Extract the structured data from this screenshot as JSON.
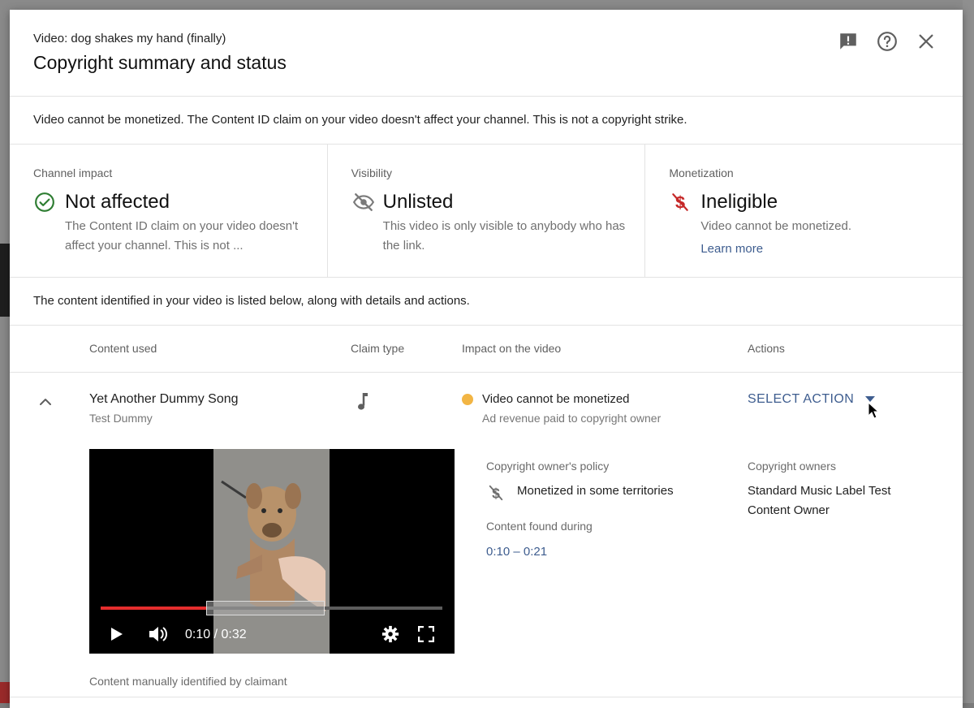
{
  "dialog": {
    "video_title": "Video: dog shakes my hand (finally)",
    "title": "Copyright summary and status",
    "header_icons": [
      "feedback-icon",
      "help-icon",
      "close-icon"
    ]
  },
  "notice": "Video cannot be monetized. The Content ID claim on your video doesn't affect your channel. This is not a copyright strike.",
  "impacts": {
    "channel": {
      "label": "Channel impact",
      "value": "Not affected",
      "desc": "The Content ID claim on your video doesn't affect your channel. This is not ...",
      "icon": "check-circle-icon",
      "color": "#2e7d32"
    },
    "visibility": {
      "label": "Visibility",
      "value": "Unlisted",
      "desc": "This video is only visible to anybody who has the link.",
      "icon": "eye-off-icon"
    },
    "monetization": {
      "label": "Monetization",
      "value": "Ineligible",
      "desc": "Video cannot be monetized.",
      "link": "Learn more",
      "icon": "no-dollar-icon",
      "color": "#c62828"
    }
  },
  "intro": "The content identified in your video is listed below, along with details and actions.",
  "table": {
    "headers": {
      "content": "Content used",
      "claim_type": "Claim type",
      "impact": "Impact on the video",
      "actions": "Actions"
    },
    "row": {
      "title": "Yet Another Dummy Song",
      "artist": "Test Dummy",
      "claim_icon": "music-note-icon",
      "impact_main": "Video cannot be monetized",
      "impact_sub": "Ad revenue paid to copyright owner",
      "impact_color": "#f2b544",
      "action_label": "SELECT ACTION",
      "player": {
        "time": "0:10 / 0:32",
        "progress_fraction": 0.31
      },
      "note": "Content manually identified by claimant",
      "policy_label": "Copyright owner's policy",
      "policy_value": "Monetized in some territories",
      "found_label": "Content found during",
      "found_value": "0:10 – 0:21",
      "owners_label": "Copyright owners",
      "owners_value": "Standard Music Label Test Content Owner"
    }
  }
}
